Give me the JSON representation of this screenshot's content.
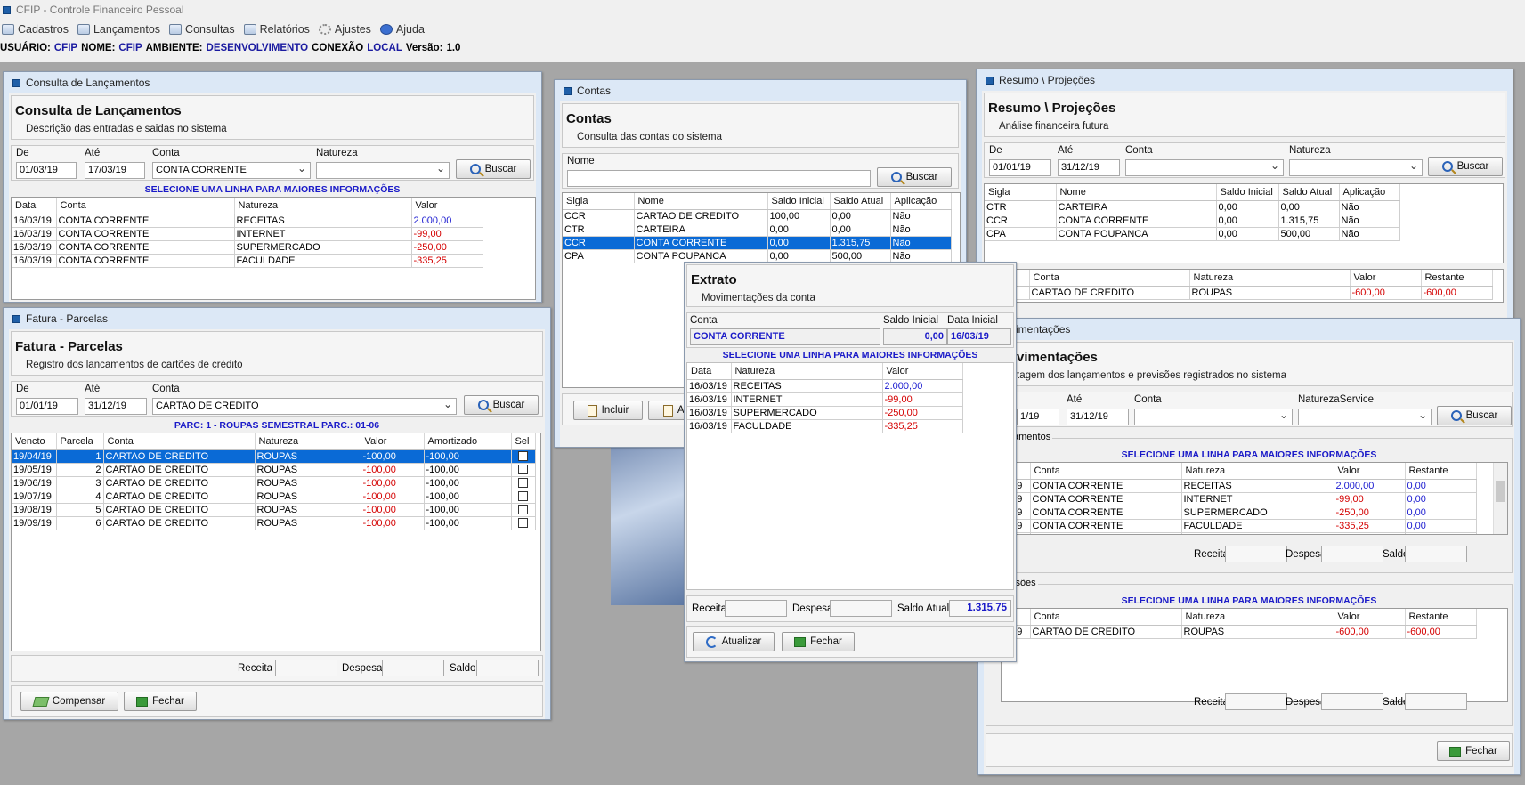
{
  "app": {
    "title": "CFIP - Controle Financeiro Pessoal",
    "menu": [
      "Cadastros",
      "Lançamentos",
      "Consultas",
      "Relatórios",
      "Ajustes",
      "Ajuda"
    ],
    "status": {
      "usuario_label": "USUÁRIO:",
      "usuario": "CFIP",
      "nome_label": "NOME:",
      "nome": "CFIP",
      "ambiente_label": "AMBIENTE:",
      "ambiente": "DESENVOLVIMENTO",
      "conexao_label": "CONEXÃO",
      "conexao": "LOCAL",
      "versao_label": "Versão:",
      "versao": "1.0"
    }
  },
  "consulta": {
    "window_title": "Consulta de Lançamentos",
    "heading": "Consulta de Lançamentos",
    "subheading": "Descrição das entradas e saidas no sistema",
    "labels": {
      "de": "De",
      "ate": "Até",
      "conta": "Conta",
      "natureza": "Natureza"
    },
    "de": "01/03/19",
    "ate": "17/03/19",
    "conta": "CONTA CORRENTE",
    "natureza": "",
    "buscar": "Buscar",
    "caption": "SELECIONE UMA LINHA PARA MAIORES INFORMAÇÕES",
    "columns": [
      "Data",
      "Conta",
      "Natureza",
      "Valor"
    ],
    "rows": [
      [
        "16/03/19",
        "CONTA CORRENTE",
        "RECEITAS",
        "2.000,00"
      ],
      [
        "16/03/19",
        "CONTA CORRENTE",
        "INTERNET",
        "-99,00"
      ],
      [
        "16/03/19",
        "CONTA CORRENTE",
        "SUPERMERCADO",
        "-250,00"
      ],
      [
        "16/03/19",
        "CONTA CORRENTE",
        "FACULDADE",
        "-335,25"
      ]
    ]
  },
  "fatura": {
    "window_title": "Fatura - Parcelas",
    "heading": "Fatura - Parcelas",
    "subheading": "Registro dos lancamentos de cartões de crédito",
    "labels": {
      "de": "De",
      "ate": "Até",
      "conta": "Conta"
    },
    "de": "01/01/19",
    "ate": "31/12/19",
    "conta": "CARTAO DE CREDITO",
    "buscar": "Buscar",
    "caption": "PARC: 1 - ROUPAS SEMESTRAL PARC.: 01-06",
    "columns": [
      "Vencto",
      "Parcela",
      "Conta",
      "Natureza",
      "Valor",
      "Amortizado",
      "Sel"
    ],
    "rows": [
      [
        "19/04/19",
        "1",
        "CARTAO DE CREDITO",
        "ROUPAS",
        "-100,00",
        "-100,00"
      ],
      [
        "19/05/19",
        "2",
        "CARTAO DE CREDITO",
        "ROUPAS",
        "-100,00",
        "-100,00"
      ],
      [
        "19/06/19",
        "3",
        "CARTAO DE CREDITO",
        "ROUPAS",
        "-100,00",
        "-100,00"
      ],
      [
        "19/07/19",
        "4",
        "CARTAO DE CREDITO",
        "ROUPAS",
        "-100,00",
        "-100,00"
      ],
      [
        "19/08/19",
        "5",
        "CARTAO DE CREDITO",
        "ROUPAS",
        "-100,00",
        "-100,00"
      ],
      [
        "19/09/19",
        "6",
        "CARTAO DE CREDITO",
        "ROUPAS",
        "-100,00",
        "-100,00"
      ]
    ],
    "footer": {
      "receita": "Receita",
      "despesa": "Despesa",
      "saldo": "Saldo"
    },
    "compensar": "Compensar",
    "fechar": "Fechar"
  },
  "contas": {
    "window_title": "Contas",
    "heading": "Contas",
    "subheading": "Consulta das contas do sistema",
    "nome_label": "Nome",
    "nome": "",
    "buscar": "Buscar",
    "columns": [
      "Sigla",
      "Nome",
      "Saldo Inicial",
      "Saldo Atual",
      "Aplicação"
    ],
    "rows": [
      [
        "CCR",
        "CARTAO DE CREDITO",
        "100,00",
        "0,00",
        "Não"
      ],
      [
        "CTR",
        "CARTEIRA",
        "0,00",
        "0,00",
        "Não"
      ],
      [
        "CCR",
        "CONTA CORRENTE",
        "0,00",
        "1.315,75",
        "Não"
      ],
      [
        "CPA",
        "CONTA POUPANCA",
        "0,00",
        "500,00",
        "Não"
      ]
    ],
    "incluir": "Incluir",
    "alterar": "Al"
  },
  "extrato": {
    "heading": "Extrato",
    "subheading": "Movimentações da conta",
    "labels": {
      "conta": "Conta",
      "saldo_inicial": "Saldo Inicial",
      "data_inicial": "Data Inicial"
    },
    "conta": "CONTA CORRENTE",
    "saldo_inicial": "0,00",
    "data_inicial": "16/03/19",
    "caption": "SELECIONE UMA LINHA PARA MAIORES INFORMAÇÕES",
    "columns": [
      "Data",
      "Natureza",
      "Valor"
    ],
    "rows": [
      [
        "16/03/19",
        "RECEITAS",
        "2.000,00"
      ],
      [
        "16/03/19",
        "INTERNET",
        "-99,00"
      ],
      [
        "16/03/19",
        "SUPERMERCADO",
        "-250,00"
      ],
      [
        "16/03/19",
        "FACULDADE",
        "-335,25"
      ]
    ],
    "footer": {
      "receita": "Receita",
      "despesa": "Despesa",
      "saldo_atual": "Saldo Atual",
      "saldo_atual_value": "1.315,75"
    },
    "atualizar": "Atualizar",
    "fechar": "Fechar"
  },
  "resumo": {
    "window_title": "Resumo \\ Projeções",
    "heading": "Resumo \\ Projeções",
    "subheading": "Análise financeira futura",
    "labels": {
      "de": "De",
      "ate": "Até",
      "conta": "Conta",
      "natureza": "Natureza"
    },
    "de": "01/01/19",
    "ate": "31/12/19",
    "buscar": "Buscar",
    "columns": [
      "Sigla",
      "Nome",
      "Saldo Inicial",
      "Saldo Atual",
      "Aplicação"
    ],
    "rows": [
      [
        "CTR",
        "CARTEIRA",
        "0,00",
        "0,00",
        "Não"
      ],
      [
        "CCR",
        "CONTA CORRENTE",
        "0,00",
        "1.315,75",
        "Não"
      ],
      [
        "CPA",
        "CONTA POUPANCA",
        "0,00",
        "500,00",
        "Não"
      ]
    ],
    "columns2": [
      "",
      "Conta",
      "Natureza",
      "Valor",
      "Restante"
    ],
    "rows2": [
      [
        "19",
        "CARTAO DE CREDITO",
        "ROUPAS",
        "-600,00",
        "-600,00"
      ]
    ]
  },
  "movimentacoes": {
    "window_title": "vimentações",
    "heading": "vimentações",
    "subheading": "tagem dos lançamentos e previsões registrados no sistema",
    "labels": {
      "ate": "Até",
      "conta": "Conta",
      "natureza": "NaturezaService"
    },
    "de": "1/19",
    "ate": "31/12/19",
    "buscar": "Buscar",
    "group1": "amentos",
    "group2": "isões",
    "caption": "SELECIONE UMA LINHA PARA MAIORES INFORMAÇÕES",
    "columns": [
      "a",
      "Conta",
      "Natureza",
      "Valor",
      "Restante"
    ],
    "rows": [
      [
        "3/19",
        "CONTA CORRENTE",
        "RECEITAS",
        "2.000,00",
        "0,00"
      ],
      [
        "3/19",
        "CONTA CORRENTE",
        "INTERNET",
        "-99,00",
        "0,00"
      ],
      [
        "3/19",
        "CONTA CORRENTE",
        "SUPERMERCADO",
        "-250,00",
        "0,00"
      ],
      [
        "3/19",
        "CONTA CORRENTE",
        "FACULDADE",
        "-335,25",
        "0,00"
      ],
      [
        "3/19",
        "CARTAO DE CREDITO",
        "ROUPAS",
        "-600,00",
        "-600,00"
      ]
    ],
    "rows2": [
      [
        "3/19",
        "CARTAO DE CREDITO",
        "ROUPAS",
        "-600,00",
        "-600,00"
      ]
    ],
    "footer": {
      "receita": "Receita",
      "despesa": "Despesa",
      "saldo": "Saldo"
    },
    "fechar": "Fechar"
  }
}
